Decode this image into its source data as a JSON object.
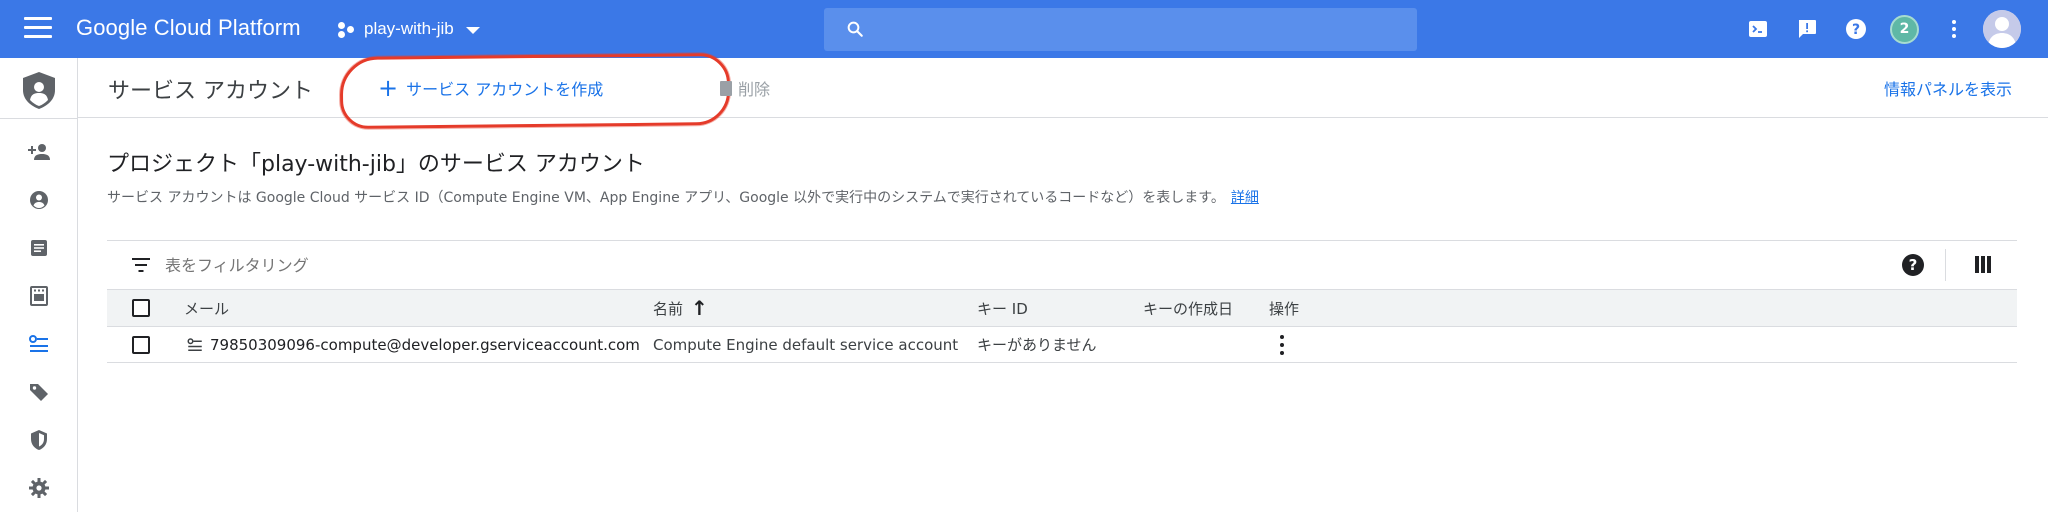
{
  "topbar": {
    "brand": "Google Cloud Platform",
    "project_name": "play-with-jib",
    "search_placeholder": "",
    "notification_count": "2",
    "icons": [
      "menu-icon",
      "project-dots-icon",
      "caret-down-icon",
      "search-icon",
      "cloud-shell-icon",
      "feedback-icon",
      "help-icon",
      "more-vert-icon",
      "account-avatar-icon"
    ]
  },
  "leftnav": {
    "items": [
      "add-member-icon",
      "account-circle-icon",
      "article-icon",
      "badge-icon",
      "service-account-icon",
      "tag-icon",
      "shield-icon",
      "gear-icon"
    ],
    "active_index": 4
  },
  "header": {
    "title": "サービス アカウント",
    "create_label": "サービス アカウントを作成",
    "delete_label": "削除",
    "info_panel_label": "情報パネルを表示"
  },
  "section": {
    "title": "プロジェクト「play-with-jib」のサービス アカウント",
    "description": "サービス アカウントは Google Cloud サービス ID（Compute Engine VM、App Engine アプリ、Google 以外で実行中のシステムで実行されているコードなど）を表します。",
    "details_link": "詳細"
  },
  "filter": {
    "placeholder": "表をフィルタリング"
  },
  "table": {
    "columns": {
      "email": "メール",
      "name": "名前",
      "key_id": "キー ID",
      "key_created": "キーの作成日",
      "actions": "操作"
    },
    "sort_indicator": "↑",
    "rows": [
      {
        "email": "79850309096-compute@developer.gserviceaccount.com",
        "name": "Compute Engine default service account",
        "key_id": "キーがありません",
        "key_created": ""
      }
    ]
  },
  "colors": {
    "topbar": "#3b78e7",
    "accent": "#1a73e8",
    "highlight": "#e53b2a"
  }
}
